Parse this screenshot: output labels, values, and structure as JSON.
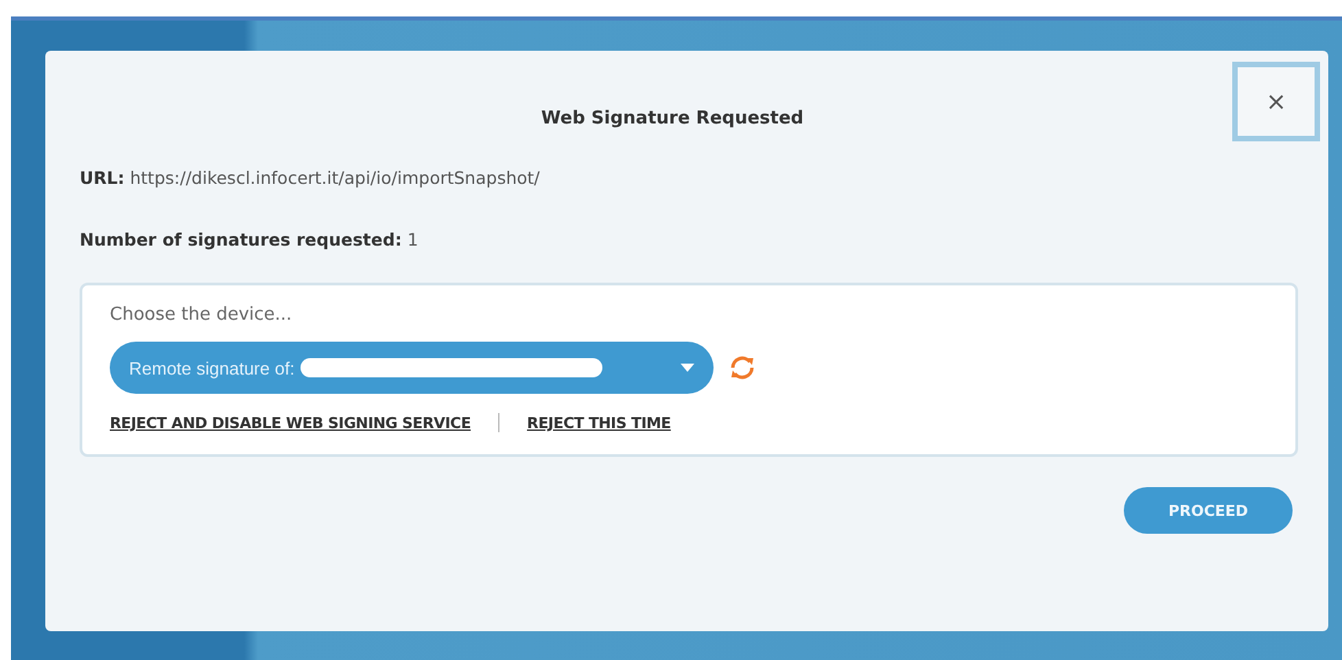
{
  "dialog": {
    "title": "Web Signature Requested",
    "close": "×",
    "url": {
      "label": "URL:",
      "value": "https://dikescl.infocert.it/api/io/importSnapshot/"
    },
    "signatures": {
      "label": "Number of signatures requested:",
      "value": "1"
    },
    "device": {
      "prompt": "Choose the device...",
      "selected_value": "Remote signature of:",
      "links": [
        "REJECT AND DISABLE WEB SIGNING SERVICE",
        "REJECT THIS TIME"
      ]
    },
    "buttons": [
      "PROCEED"
    ]
  }
}
